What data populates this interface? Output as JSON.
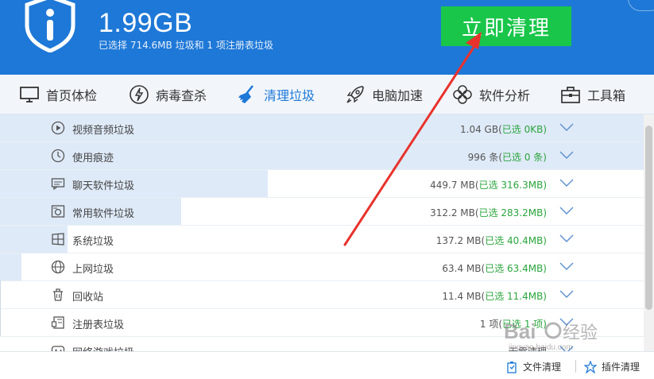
{
  "header": {
    "size": "1.99GB",
    "subtitle": "已选择 714.6MB 垃圾和 1 项注册表垃圾",
    "clean_button": "立即清理",
    "bg_color": "#1e78d7",
    "button_color": "#19c64a"
  },
  "tabs": [
    {
      "label": "首页体检",
      "icon": "monitor-icon"
    },
    {
      "label": "病毒查杀",
      "icon": "lightning-icon"
    },
    {
      "label": "清理垃圾",
      "icon": "broom-icon",
      "active": true
    },
    {
      "label": "电脑加速",
      "icon": "rocket-icon"
    },
    {
      "label": "软件分析",
      "icon": "flower-icon"
    },
    {
      "label": "工具箱",
      "icon": "toolbox-icon"
    }
  ],
  "rows": [
    {
      "label": "视频音频垃圾",
      "size": "1.04 GB(",
      "selected": "已选 0KB)",
      "icon": "play-icon",
      "fill": 1.0
    },
    {
      "label": "使用痕迹",
      "size": "996 条(",
      "selected": "已选 0 条)",
      "icon": "clock-icon",
      "fill": 1.0
    },
    {
      "label": "聊天软件垃圾",
      "size": "449.7 MB(",
      "selected": "已选 316.3MB)",
      "icon": "chat-icon",
      "fill": 0.416
    },
    {
      "label": "常用软件垃圾",
      "size": "312.2 MB(",
      "selected": "已选 283.2MB)",
      "icon": "disk-icon",
      "fill": 0.281
    },
    {
      "label": "系统垃圾",
      "size": "137.2 MB(",
      "selected": "已选 40.4MB)",
      "icon": "windows-icon",
      "fill": 0.105
    },
    {
      "label": "上网垃圾",
      "size": "63.4 MB(",
      "selected": "已选 63.4MB)",
      "icon": "globe-icon",
      "fill": 0.033
    },
    {
      "label": "回收站",
      "size": "11.4 MB(",
      "selected": "已选 11.4MB)",
      "icon": "trash-icon",
      "fill": 0
    },
    {
      "label": "注册表垃圾",
      "size": "1 项(",
      "selected": "已选 1 项)",
      "icon": "registry-icon",
      "fill": 0
    },
    {
      "label": "网络游戏垃圾",
      "size": "无需清理",
      "selected": "",
      "icon": "gamepad-icon",
      "fill": 0
    }
  ],
  "footer": {
    "file_clean": "文件清理",
    "plugin_clean": "插件清理"
  },
  "watermark": {
    "text": "Baidu 经验",
    "url": "jingyan.baidu.com"
  }
}
